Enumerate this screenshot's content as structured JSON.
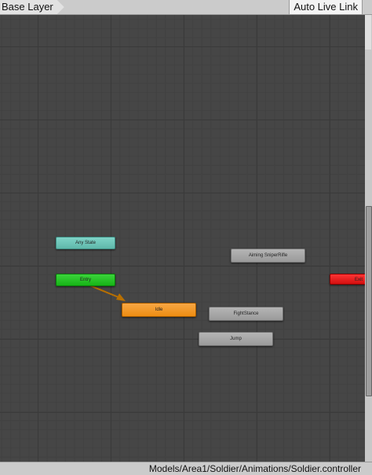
{
  "toolbar": {
    "breadcrumb": "Base Layer",
    "live_link_label": "Auto Live Link"
  },
  "graph": {
    "states": {
      "any_state": "Any State",
      "entry": "Entry",
      "idle": "Idle",
      "aiming": "Aiming SniperRifle",
      "fight_stance": "FightStance",
      "jump": "Jump",
      "exit": "Exit"
    }
  },
  "statusbar": {
    "controller_path": "Models/Area1/Soldier/Animations/Soldier.controller"
  },
  "colors": {
    "entry": "#16b416",
    "any_state": "#5fb8aa",
    "default_state": "#ee8d12",
    "exit": "#d20f0f",
    "transition_arrow": "#b76f00"
  }
}
